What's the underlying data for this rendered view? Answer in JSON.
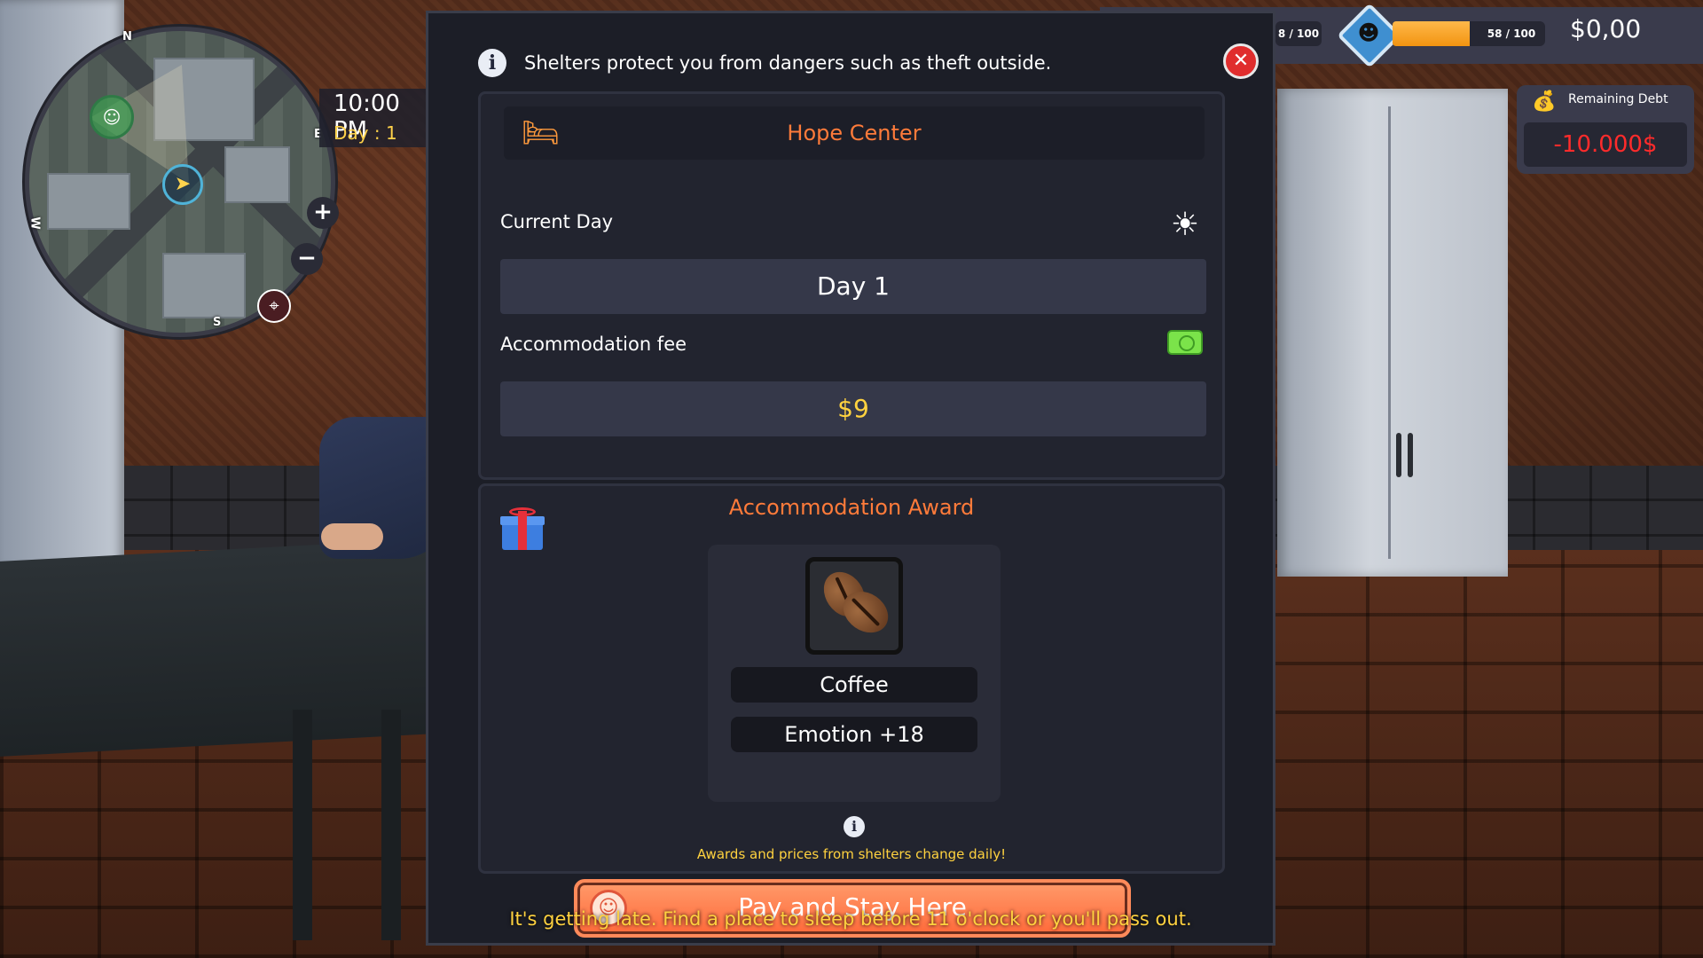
{
  "hud": {
    "time": "10:00 PM",
    "day": "Day : 1",
    "compass": {
      "n": "N",
      "e": "E",
      "s": "S",
      "w": "W"
    },
    "zoom_in": "+",
    "zoom_out": "−",
    "stat_left": "8 / 100",
    "emotion": {
      "value_text": "58 / 100",
      "fraction": 0.58
    },
    "money": "$0,00",
    "debt": {
      "label": "Remaining Debt",
      "value": "-10.000$"
    }
  },
  "modal": {
    "info_text": "Shelters protect you from dangers such as theft outside.",
    "close_icon": "close-icon",
    "shelter_name": "Hope Center",
    "current_day_label": "Current Day",
    "current_day_value": "Day 1",
    "fee_label": "Accommodation fee",
    "fee_value": "$9",
    "award_title": "Accommodation Award",
    "award_item": "Coffee",
    "award_effect": "Emotion +18",
    "note_text": "Awards and prices from shelters change daily!",
    "pay_button": "Pay and Stay Here",
    "warning_text": "It's getting late. Find a place to sleep before 11 o'clock or you'll pass out."
  },
  "icons": [
    "info-icon",
    "close-icon",
    "bed-icon",
    "sun-icon",
    "cash-icon",
    "gift-icon",
    "coffee-beans-icon",
    "money-bag-icon",
    "emotion-face-icon"
  ]
}
